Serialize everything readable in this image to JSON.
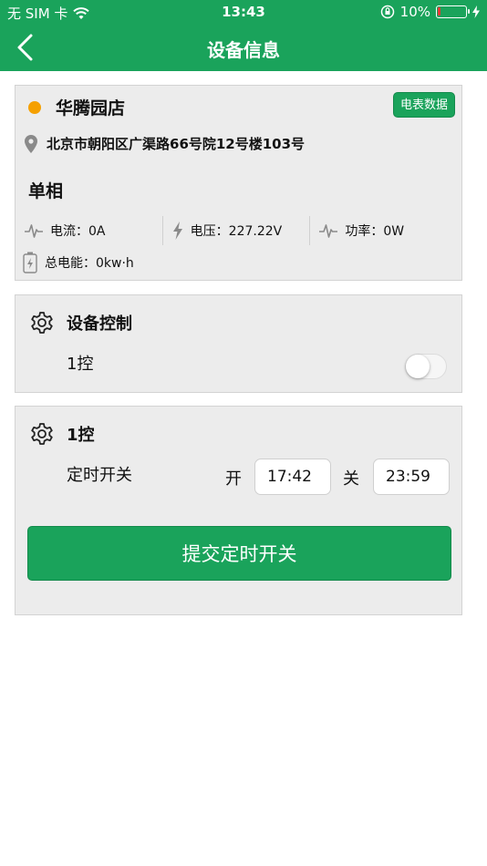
{
  "status_bar": {
    "carrier": "无 SIM 卡",
    "time": "13:43",
    "battery": "10%",
    "battery_level": 0.1,
    "icons": [
      "wifi-icon",
      "orientation-lock-icon",
      "battery-icon",
      "charging-icon"
    ]
  },
  "nav": {
    "title": "设备信息",
    "back_icon": "chevron-left-icon"
  },
  "store": {
    "name": "华腾园店",
    "status_color": "#f5a000",
    "meter_button": "电表数据",
    "address": "北京市朝阳区广渠路66号院12号楼103号",
    "phase": "单相",
    "metrics": [
      {
        "icon": "pulse-icon",
        "label": "电流：0A"
      },
      {
        "icon": "lightning-icon",
        "label": "电压：227.22V"
      },
      {
        "icon": "pulse-icon",
        "label": "功率：0W"
      }
    ],
    "energy": {
      "icon": "battery-icon",
      "label": "总电能：0kw·h"
    }
  },
  "device_control": {
    "title": "设备控制",
    "items": [
      {
        "label": "1控",
        "enabled": false
      }
    ]
  },
  "timer": {
    "title": "1控",
    "label": "定时开关",
    "on_label": "开",
    "on_time": "17:42",
    "off_label": "关",
    "off_time": "23:59",
    "submit": "提交定时开关"
  },
  "colors": {
    "accent": "#1aa35b",
    "card_bg": "#ececec"
  }
}
